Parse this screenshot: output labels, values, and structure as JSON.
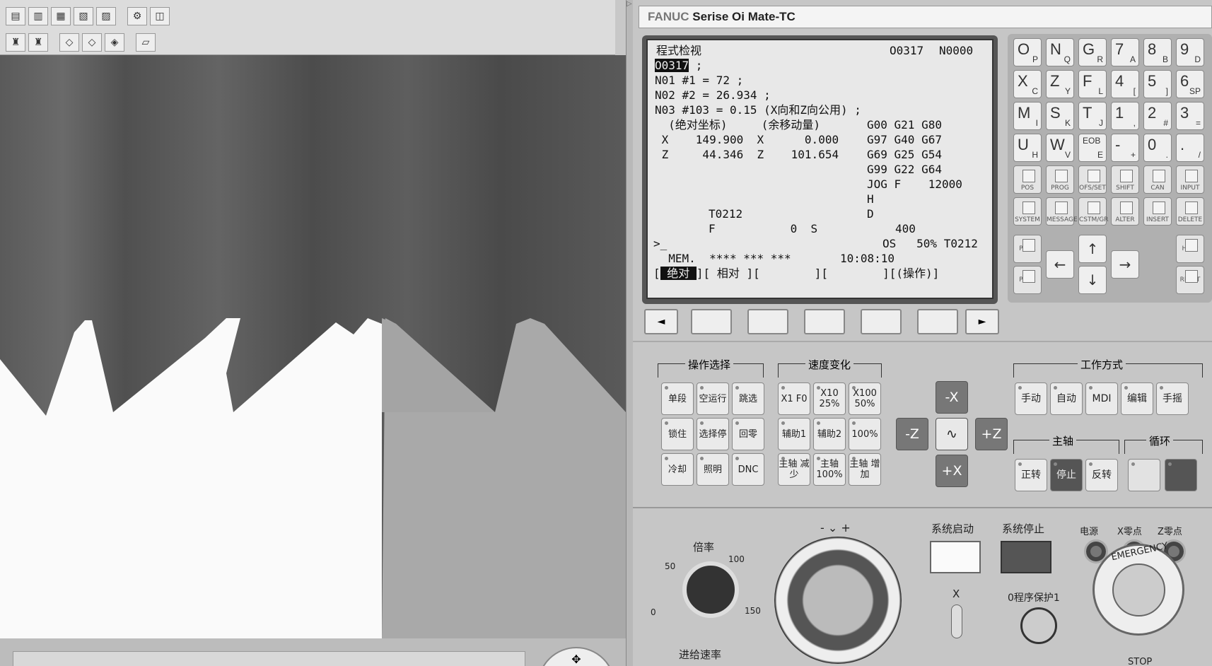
{
  "toolbar": {
    "row1": [
      "file-new-icon",
      "file-open-icon",
      "file-save-icon",
      "file-open2-icon",
      "file-saveas-icon",
      "settings-icon",
      "cube-icon"
    ],
    "row2": [
      "tool-icon",
      "tool2-icon",
      "eraser-icon",
      "eraser2-icon",
      "eraser3-icon",
      "ruler-icon"
    ]
  },
  "brand": {
    "fanuc": "FANUC",
    "rest": "Serise Oi Mate-TC"
  },
  "screen": {
    "title": "程式检视",
    "prog_no": "O0317",
    "seq_no": "N0000",
    "line_prog": "O0317",
    "line_prog_end": " ;",
    "line1": "N01 #1 = 72 ;",
    "line2": "N02 #2 = 26.934 ;",
    "line3": "N03 #103 = 0.15 (X向和Z向公用) ;",
    "hdr": "  (绝对坐标)     (余移动量)",
    "g1": "G00 G21 G80",
    "x_row": " X    149.900  X      0.000",
    "g2": "G97 G40 G67",
    "z_row": " Z     44.346  Z    101.654",
    "g3": "G69 G25 G54",
    "g4": "G99 G22 G64",
    "jog": "JOG F    12000",
    "h": "H",
    "tool": "T0212",
    "d": "D",
    "fs": "F           0  S",
    "s_val": "400",
    "prompt": ">_",
    "os_row": "OS   50% T0212",
    "mem": "  MEM.  **** *** ***",
    "time": "10:08:10",
    "soft_sel": " 绝对 ",
    "soft_rest": "][ 相对 ][        ][        ][(操作)]"
  },
  "softkeys": {
    "left": "◄",
    "right": "►"
  },
  "keypad": {
    "keys": [
      {
        "m": "O",
        "s": "P"
      },
      {
        "m": "N",
        "s": "Q"
      },
      {
        "m": "G",
        "s": "R"
      },
      {
        "m": "7",
        "s": "A"
      },
      {
        "m": "8",
        "s": "B"
      },
      {
        "m": "9",
        "s": "D"
      },
      {
        "m": "X",
        "s": "C"
      },
      {
        "m": "Z",
        "s": "Y"
      },
      {
        "m": "F",
        "s": "L"
      },
      {
        "m": "4",
        "s": "["
      },
      {
        "m": "5",
        "s": "]"
      },
      {
        "m": "6",
        "s": "SP"
      },
      {
        "m": "M",
        "s": "I"
      },
      {
        "m": "S",
        "s": "K"
      },
      {
        "m": "T",
        "s": "J"
      },
      {
        "m": "1",
        "s": ","
      },
      {
        "m": "2",
        "s": "#"
      },
      {
        "m": "3",
        "s": "="
      },
      {
        "m": "U",
        "s": "H"
      },
      {
        "m": "W",
        "s": "V"
      },
      {
        "m": "EOB",
        "s": "E"
      },
      {
        "m": "-",
        "s": "+"
      },
      {
        "m": "0",
        "s": "."
      },
      {
        "m": ".",
        "s": "/"
      }
    ],
    "fkeys": [
      "POS",
      "PROG",
      "OFS/SET",
      "SHIFT",
      "CAN",
      "INPUT",
      "SYSTEM",
      "MESSAGE",
      "CSTM/GR",
      "ALTER",
      "INSERT",
      "DELETE"
    ],
    "page_up": "PAGE",
    "page_down": "PAGE",
    "help": "HELP",
    "reset": "RESET"
  },
  "groups": {
    "op": "操作选择",
    "speed": "速度变化",
    "mode": "工作方式",
    "spindle": "主轴",
    "cycle": "循环"
  },
  "opbuttons": [
    "单段",
    "空运行",
    "跳选",
    "锁住",
    "选择停",
    "回零",
    "冷却",
    "照明",
    "DNC"
  ],
  "speedbuttons": [
    "X1 F0",
    "X10 25%",
    "X100 50%",
    "辅助1",
    "辅助2",
    "100%",
    "主轴 减少",
    "主轴 100%",
    "主轴 增加"
  ],
  "jog": {
    "mx": "-X",
    "mz": "-Z",
    "rapid": "∿",
    "pz": "+Z",
    "px": "+X"
  },
  "modebuttons": [
    "手动",
    "自动",
    "MDI",
    "编辑",
    "手摇"
  ],
  "spindlebuttons": [
    "正转",
    "停止",
    "反转"
  ],
  "lower": {
    "rate": "倍率",
    "r50": "50",
    "r100": "100",
    "r0": "0",
    "r150": "150",
    "feed": "进给速率",
    "wheel_sign": "- ⌄ +",
    "start": "系统启动",
    "stop": "系统停止",
    "power": "电源",
    "xzero": "X零点",
    "zzero": "Z零点",
    "axis": "X",
    "protect": "0程序保护1",
    "estop_top": "EMERGENCY",
    "estop_bot": "STOP"
  }
}
